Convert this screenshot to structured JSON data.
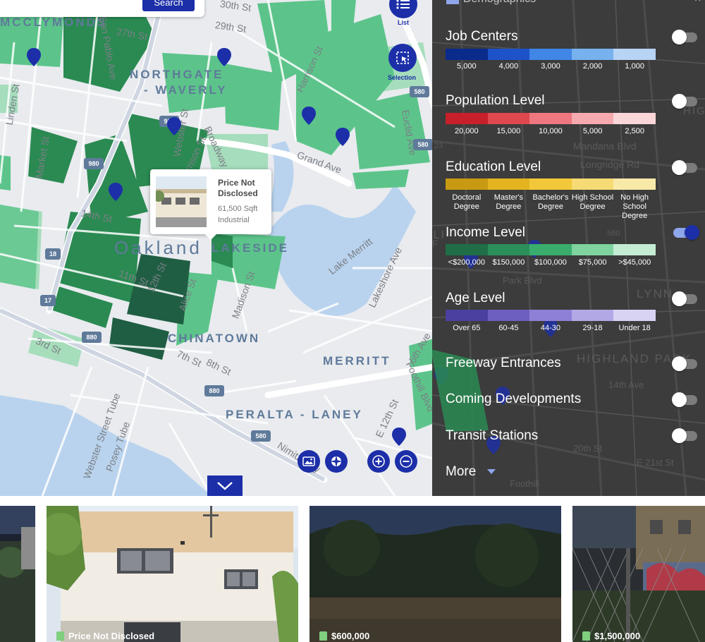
{
  "search": {
    "button_label": "Search"
  },
  "map": {
    "buttons": {
      "list_label": "List",
      "selection_label": "Selection"
    },
    "neighborhoods": [
      "MCCLYMONDS",
      "NORTHGATE",
      "- WAVERLY",
      "Oakland",
      "LAKESIDE",
      "CHINATOWN",
      "MERRITT",
      "PERALTA - LANEY"
    ],
    "streets": [
      "30th St",
      "29th St",
      "27th St",
      "San Pablo Ave",
      "Linden St",
      "Market St",
      "14th St",
      "12th St",
      "Harrison St",
      "Grand Ave",
      "Euclid Ave",
      "Madison St",
      "Lake Merritt",
      "Lakeshore Ave",
      "8th St",
      "7th St",
      "3rd St",
      "Webster Street Tube",
      "Posey Tube",
      "Nimitz Fwy",
      "E 12th St",
      "5th Ave",
      "Foothill Blvd",
      "Harrison St",
      "Broadway",
      "Webster St",
      "11th St",
      "Alice St"
    ],
    "highways": [
      "980",
      "980",
      "580",
      "880",
      "18",
      "17",
      "880",
      "580",
      "580"
    ],
    "popup": {
      "title": "Price Not Disclosed",
      "size": "61,500 Sqft",
      "type": "Industrial"
    }
  },
  "panel": {
    "header": "Demographics",
    "layers": [
      {
        "title": "Job Centers",
        "enabled": false,
        "colors": [
          "#0a2a8c",
          "#1d52c9",
          "#3f86e6",
          "#77b1ee",
          "#b8d4f5"
        ],
        "labels": [
          "5,000",
          "4,000",
          "3,000",
          "2,000",
          "1,000"
        ]
      },
      {
        "title": "Population Level",
        "enabled": false,
        "colors": [
          "#c8202a",
          "#e0474e",
          "#ef7780",
          "#f6a9af",
          "#fbd6d8"
        ],
        "labels": [
          "20,000",
          "15,000",
          "10,000",
          "5,000",
          "2,500"
        ]
      },
      {
        "title": "Education Level",
        "enabled": false,
        "colors": [
          "#c79a12",
          "#e3b420",
          "#f2c83a",
          "#f6da74",
          "#f9e9a8"
        ],
        "labels": [
          "Doctoral Degree",
          "Master's Degree",
          "Bachelor's Degree",
          "High School Degree",
          "No High School Degree"
        ]
      },
      {
        "title": "Income Level",
        "enabled": true,
        "colors": [
          "#1f6e47",
          "#2b8f5a",
          "#3aad6d",
          "#7ed39e",
          "#c4ecd3"
        ],
        "labels": [
          "<$200,000",
          "$150,000",
          "$100,000",
          "$75,000",
          ">$45,000"
        ]
      },
      {
        "title": "Age Level",
        "enabled": false,
        "colors": [
          "#4b3fa0",
          "#6d5fc0",
          "#8e80d6",
          "#b3a8e6",
          "#d8d2f3"
        ],
        "labels": [
          "Over 65",
          "60-45",
          "44-30",
          "29-18",
          "Under 18"
        ]
      }
    ],
    "toggles": [
      {
        "title": "Freeway Entrances",
        "enabled": false
      },
      {
        "title": "Coming Developments",
        "enabled": false
      },
      {
        "title": "Transit Stations",
        "enabled": false
      }
    ],
    "more_label": "More",
    "background_labels": [
      "HIGHLAND PARK",
      "LYNN",
      "HIGH",
      "Mandana Blvd",
      "Longridge Rd",
      "Park Blvd",
      "E 21st St",
      "20th St",
      "Foothill",
      "14th Ave",
      "CLI",
      "FF",
      "23",
      "580"
    ]
  },
  "listings": [
    {
      "price": ""
    },
    {
      "price": "Price Not Disclosed"
    },
    {
      "price": "$600,000"
    },
    {
      "price": "$1,500,000"
    }
  ],
  "colors": {
    "accent": "#1c2fa8",
    "panel_bg": "#3c3c3c",
    "map_bg": "#e9ebef",
    "parcel_light": "#5cc48a",
    "parcel_mid": "#2a8a52",
    "parcel_dark": "#1f5e43"
  }
}
